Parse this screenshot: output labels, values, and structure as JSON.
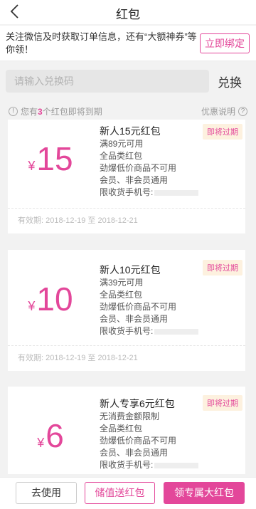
{
  "header": {
    "title": "红包"
  },
  "wechat_notice": {
    "text": "关注微信及时获取订单信息，还有“大额神券”等你领！",
    "bind_label": "立即绑定"
  },
  "redeem": {
    "placeholder": "请输入兑换码",
    "button_label": "兑换"
  },
  "summary": {
    "prefix": "您有",
    "count": "3",
    "suffix": "个红包即将到期",
    "help_label": "优惠说明",
    "info_icon": "!",
    "help_icon": "?"
  },
  "coupons": [
    {
      "currency": "¥",
      "amount": "15",
      "title": "新人15元红包",
      "lines": [
        "满89元可用",
        "全品类红包",
        "劲爆低价商品不可用",
        "会员、非会员通用"
      ],
      "phone_label": "限收货手机号:",
      "tag": "即将过期",
      "validity": "有效期: 2018-12-19 至 2018-12-21"
    },
    {
      "currency": "¥",
      "amount": "10",
      "title": "新人10元红包",
      "lines": [
        "满39元可用",
        "全品类红包",
        "劲爆低价商品不可用",
        "会员、非会员通用"
      ],
      "phone_label": "限收货手机号:",
      "tag": "即将过期",
      "validity": "有效期: 2018-12-19 至 2018-12-21"
    },
    {
      "currency": "¥",
      "amount": "6",
      "title": "新人专享6元红包",
      "lines": [
        "无消费金额限制",
        "全品类红包",
        "劲爆低价商品不可用",
        "会员、非会员通用"
      ],
      "phone_label": "限收货手机号:",
      "tag": "即将过期",
      "validity": ""
    }
  ],
  "bottom_bar": {
    "use_label": "去使用",
    "recharge_label": "储值送红包",
    "big_label": "领专属大红包"
  },
  "colors": {
    "accent": "#e3479a",
    "tag_bg": "#fdf1df"
  }
}
